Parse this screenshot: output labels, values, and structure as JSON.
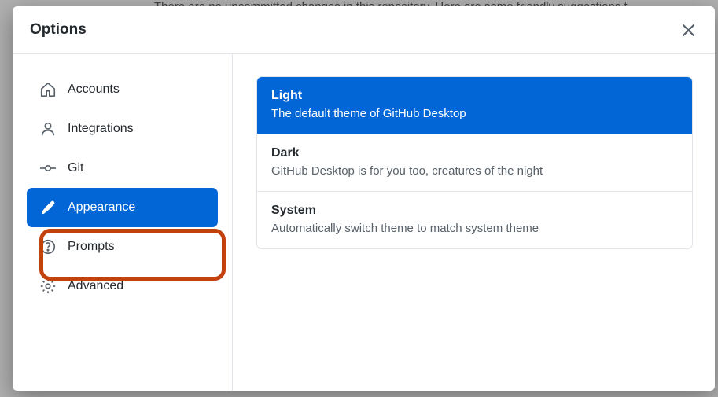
{
  "background": {
    "text": "There are no uncommitted changes in this repository. Here are some friendly suggestions t"
  },
  "modal": {
    "title": "Options"
  },
  "sidebar": {
    "items": [
      {
        "label": "Accounts",
        "selected": false
      },
      {
        "label": "Integrations",
        "selected": false
      },
      {
        "label": "Git",
        "selected": false
      },
      {
        "label": "Appearance",
        "selected": true
      },
      {
        "label": "Prompts",
        "selected": false
      },
      {
        "label": "Advanced",
        "selected": false
      }
    ]
  },
  "themes": {
    "options": [
      {
        "title": "Light",
        "desc": "The default theme of GitHub Desktop",
        "selected": true
      },
      {
        "title": "Dark",
        "desc": "GitHub Desktop is for you too, creatures of the night",
        "selected": false
      },
      {
        "title": "System",
        "desc": "Automatically switch theme to match system theme",
        "selected": false
      }
    ]
  },
  "colors": {
    "accent": "#0366d6",
    "highlight": "#c2410c"
  }
}
